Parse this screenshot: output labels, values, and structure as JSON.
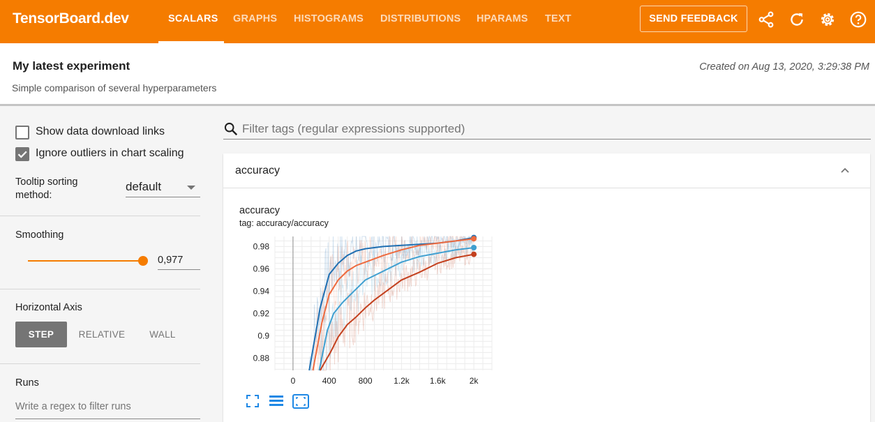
{
  "app": {
    "brand": "TensorBoard.dev",
    "tabs": [
      "SCALARS",
      "GRAPHS",
      "HISTOGRAMS",
      "DISTRIBUTIONS",
      "HPARAMS",
      "TEXT"
    ],
    "active_tab": "SCALARS",
    "feedback_label": "SEND FEEDBACK",
    "accent": "#f57c00"
  },
  "experiment": {
    "title": "My latest experiment",
    "description": "Simple comparison of several hyperparameters",
    "created": "Created on Aug 13, 2020, 3:29:38 PM"
  },
  "sidebar": {
    "show_download_label": "Show data download links",
    "show_download_checked": false,
    "ignore_outliers_label": "Ignore outliers in chart scaling",
    "ignore_outliers_checked": true,
    "tooltip_label_line1": "Tooltip sorting",
    "tooltip_label_line2": "method:",
    "tooltip_value": "default",
    "smoothing_label": "Smoothing",
    "smoothing_value": "0,977",
    "haxis_label": "Horizontal Axis",
    "haxis_options": [
      "STEP",
      "RELATIVE",
      "WALL"
    ],
    "haxis_selected": "STEP",
    "runs_label": "Runs",
    "runs_placeholder": "Write a regex to filter runs"
  },
  "main": {
    "filter_placeholder": "Filter tags (regular expressions supported)",
    "card_title": "accuracy",
    "chart_title": "accuracy",
    "chart_tag": "tag: accuracy/accuracy"
  },
  "chart_data": {
    "type": "line",
    "title": "accuracy",
    "xlabel": "",
    "ylabel": "",
    "x_ticks": [
      "0",
      "400",
      "800",
      "1.2k",
      "1.6k",
      "2k"
    ],
    "x_tick_values": [
      0,
      400,
      800,
      1200,
      1600,
      2000
    ],
    "y_ticks": [
      "0.88",
      "0.9",
      "0.92",
      "0.94",
      "0.96",
      "0.98"
    ],
    "y_tick_values": [
      0.88,
      0.9,
      0.92,
      0.94,
      0.96,
      0.98
    ],
    "xlim": [
      -200,
      2200
    ],
    "ylim": [
      0.869,
      0.989
    ],
    "grid": true,
    "series": [
      {
        "color": "#1f6fb2",
        "x": [
          180,
          300,
          400,
          500,
          600,
          700,
          800,
          1000,
          1200,
          1400,
          1600,
          1800,
          2000
        ],
        "y": [
          0.869,
          0.925,
          0.955,
          0.965,
          0.972,
          0.976,
          0.978,
          0.98,
          0.981,
          0.982,
          0.983,
          0.985,
          0.988
        ]
      },
      {
        "color": "#ee6a3e",
        "x": [
          220,
          320,
          400,
          500,
          600,
          700,
          800,
          1000,
          1200,
          1400,
          1600,
          1800,
          2000
        ],
        "y": [
          0.869,
          0.912,
          0.937,
          0.95,
          0.958,
          0.963,
          0.966,
          0.972,
          0.977,
          0.981,
          0.983,
          0.985,
          0.987
        ]
      },
      {
        "color": "#3f9fd0",
        "x": [
          290,
          380,
          450,
          550,
          650,
          750,
          800,
          1000,
          1200,
          1400,
          1600,
          1800,
          2000
        ],
        "y": [
          0.869,
          0.905,
          0.92,
          0.93,
          0.938,
          0.946,
          0.95,
          0.958,
          0.966,
          0.971,
          0.974,
          0.977,
          0.979
        ]
      },
      {
        "color": "#c3401e",
        "x": [
          300,
          420,
          500,
          600,
          700,
          800,
          900,
          1000,
          1200,
          1400,
          1600,
          1800,
          2000
        ],
        "y": [
          0.869,
          0.886,
          0.899,
          0.91,
          0.917,
          0.925,
          0.932,
          0.938,
          0.95,
          0.957,
          0.965,
          0.97,
          0.973
        ]
      }
    ]
  }
}
